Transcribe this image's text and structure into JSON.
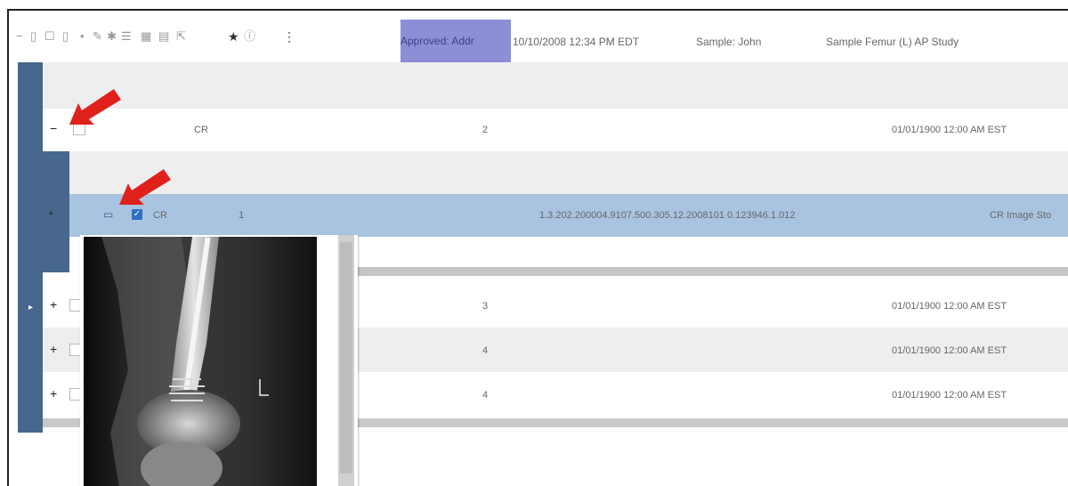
{
  "toolbar": {
    "highlighted_cell": "Approved: Addr",
    "datetime": "10/10/2008 12:34 PM EDT",
    "patient": "Sample: John",
    "study": "Sample Femur (L) AP Study"
  },
  "rows": [
    {
      "expander": "−",
      "modality": "CR",
      "number": "2",
      "date": "01/01/1900 12:00 AM EST"
    },
    {
      "expander": "+",
      "modality": "CR",
      "number": "1",
      "uid": "1.3.202.200004.9107.500.305.12.2008101 0.123946.1.012",
      "type": "CR Image Sto"
    },
    {
      "expander": "+",
      "number": "3",
      "date": "01/01/1900 12:00 AM EST"
    },
    {
      "expander": "+",
      "number": "4",
      "date": "01/01/1900 12:00 AM EST"
    },
    {
      "expander": "+",
      "number": "4",
      "date": "01/01/1900 12:00 AM EST"
    }
  ],
  "colors": {
    "navy": "#47678c",
    "selected_row": "#a9c4e0",
    "highlight": "#8d8fd6",
    "arrow": "#e0211b"
  }
}
